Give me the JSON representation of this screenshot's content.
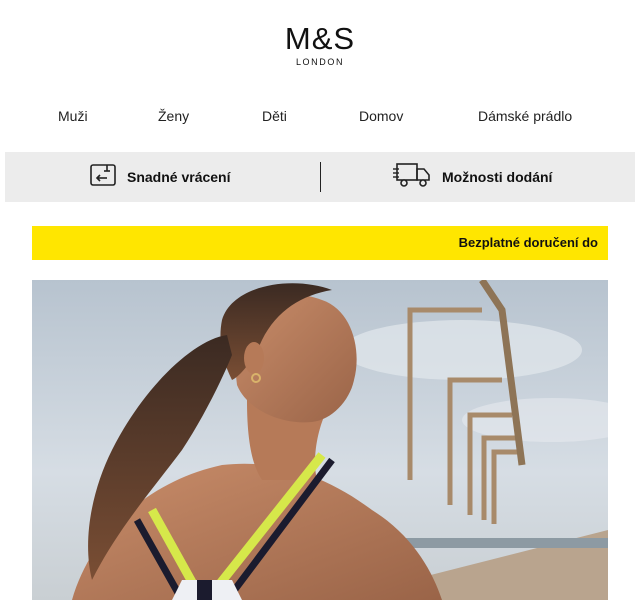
{
  "brand": {
    "name": "M&S",
    "subtitle": "LONDON"
  },
  "nav": {
    "items": [
      {
        "label": "Muži"
      },
      {
        "label": "Ženy"
      },
      {
        "label": "Děti"
      },
      {
        "label": "Domov"
      },
      {
        "label": "Dámské prádlo"
      }
    ]
  },
  "services": {
    "returns": {
      "label": "Snadné vrácení",
      "icon": "return-box-icon"
    },
    "delivery": {
      "label": "Možnosti dodání",
      "icon": "delivery-truck-icon"
    }
  },
  "promo": {
    "text": "Bezplatné doručení do",
    "color": "#ffe600"
  },
  "hero": {
    "image": "woman-in-sports-bra-photo"
  }
}
